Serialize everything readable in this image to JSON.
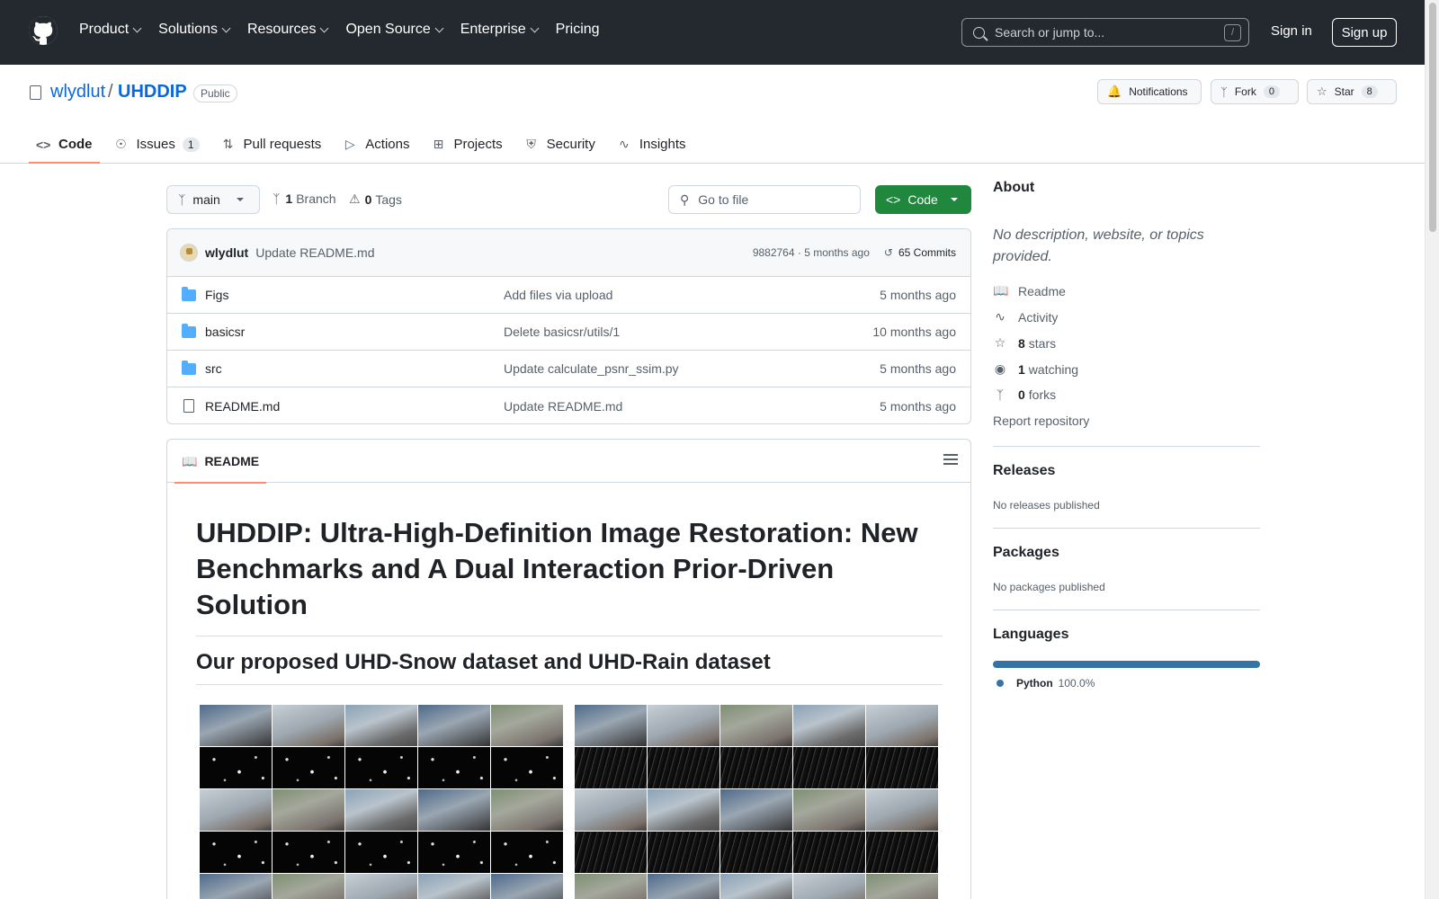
{
  "header": {
    "nav": [
      "Product",
      "Solutions",
      "Resources",
      "Open Source",
      "Enterprise",
      "Pricing"
    ],
    "search_placeholder": "Search or jump to...",
    "search_shortcut": "/",
    "sign_in": "Sign in",
    "sign_up": "Sign up"
  },
  "repo": {
    "owner": "wlydlut",
    "separator": "/",
    "name": "UHDDIP",
    "visibility": "Public",
    "notifications_label": "Notifications",
    "fork_label": "Fork",
    "fork_count": "0",
    "star_label": "Star",
    "star_count": "8"
  },
  "tabs": [
    {
      "label": "Code",
      "icon": "code-icon",
      "active": true
    },
    {
      "label": "Issues",
      "icon": "issue-icon",
      "count": "1"
    },
    {
      "label": "Pull requests",
      "icon": "pull-request-icon"
    },
    {
      "label": "Actions",
      "icon": "play-icon"
    },
    {
      "label": "Projects",
      "icon": "table-icon"
    },
    {
      "label": "Security",
      "icon": "shield-icon"
    },
    {
      "label": "Insights",
      "icon": "graph-icon"
    }
  ],
  "filenav": {
    "branch": "main",
    "branch_count": "1",
    "branch_label": "Branch",
    "tag_count": "0",
    "tag_label": "Tags",
    "goto_placeholder": "Go to file",
    "code_button": "Code"
  },
  "latest_commit": {
    "author": "wlydlut",
    "message": "Update README.md",
    "hash_time": "9882764 · 5 months ago",
    "commits": "65 Commits"
  },
  "files": [
    {
      "type": "folder",
      "name": "Figs",
      "message": "Add files via upload",
      "date": "5 months ago"
    },
    {
      "type": "folder",
      "name": "basicsr",
      "message": "Delete basicsr/utils/1",
      "date": "10 months ago"
    },
    {
      "type": "folder",
      "name": "src",
      "message": "Update calculate_psnr_ssim.py",
      "date": "5 months ago"
    },
    {
      "type": "file",
      "name": "README.md",
      "message": "Update README.md",
      "date": "5 months ago"
    }
  ],
  "readme": {
    "tab_label": "README",
    "title": "UHDDIP: Ultra-High-Definition Image Restoration: New Benchmarks and A Dual Interaction Prior-Driven Solution",
    "subtitle": "Our proposed UHD-Snow dataset and UHD-Rain dataset"
  },
  "sidebar": {
    "about_title": "About",
    "about_desc": "No description, website, or topics provided.",
    "readme": "Readme",
    "activity": "Activity",
    "stars_count": "8",
    "stars_label": "stars",
    "watching_count": "1",
    "watching_label": "watching",
    "forks_count": "0",
    "forks_label": "forks",
    "report": "Report repository",
    "releases_title": "Releases",
    "releases_sub": "No releases published",
    "packages_title": "Packages",
    "packages_sub": "No packages published",
    "languages_title": "Languages",
    "language_name": "Python",
    "language_pct": "100.0%",
    "language_color": "#3572a5"
  },
  "colors": {
    "header_bg": "#24292f",
    "link": "#0969da",
    "code_button": "#1f883d",
    "active_tab_underline": "#fd8c73"
  }
}
